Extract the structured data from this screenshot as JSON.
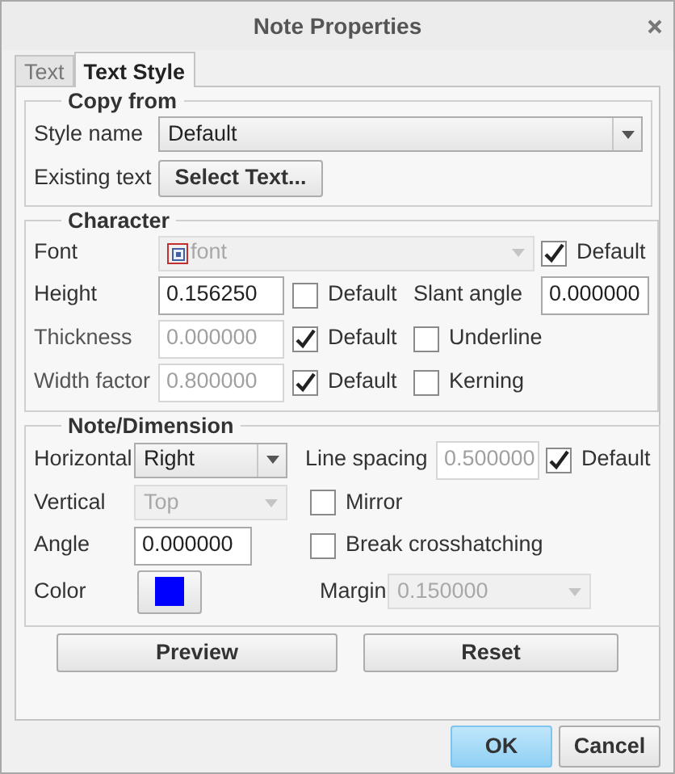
{
  "window": {
    "title": "Note Properties"
  },
  "tabs": [
    {
      "label": "Text",
      "selected": false
    },
    {
      "label": "Text Style",
      "selected": true
    }
  ],
  "copy_from": {
    "title": "Copy from",
    "style_name": {
      "label": "Style name",
      "value": "Default"
    },
    "existing_text": {
      "label": "Existing text",
      "button": "Select Text..."
    }
  },
  "character": {
    "title": "Character",
    "font": {
      "label": "Font",
      "value": "font",
      "disabled": true,
      "default": {
        "label": "Default",
        "checked": true
      }
    },
    "height": {
      "label": "Height",
      "value": "0.156250",
      "disabled": false,
      "default": {
        "label": "Default",
        "checked": false
      }
    },
    "slant_angle": {
      "label": "Slant angle",
      "value": "0.000000"
    },
    "thickness": {
      "label": "Thickness",
      "value": "0.000000",
      "disabled": true,
      "default": {
        "label": "Default",
        "checked": true
      }
    },
    "underline": {
      "label": "Underline",
      "checked": false
    },
    "width_factor": {
      "label": "Width factor",
      "value": "0.800000",
      "disabled": true,
      "default": {
        "label": "Default",
        "checked": true
      }
    },
    "kerning": {
      "label": "Kerning",
      "checked": false
    }
  },
  "note_dimension": {
    "title": "Note/Dimension",
    "horizontal": {
      "label": "Horizontal",
      "value": "Right",
      "disabled": false
    },
    "line_spacing": {
      "label": "Line spacing",
      "value": "0.500000",
      "disabled": true,
      "default": {
        "label": "Default",
        "checked": true
      }
    },
    "vertical": {
      "label": "Vertical",
      "value": "Top",
      "disabled": true
    },
    "mirror": {
      "label": "Mirror",
      "checked": false
    },
    "angle": {
      "label": "Angle",
      "value": "0.000000"
    },
    "break_crosshatching": {
      "label": "Break crosshatching",
      "checked": false
    },
    "color": {
      "label": "Color",
      "color": "#0000ff"
    },
    "margin": {
      "label": "Margin",
      "value": "0.150000",
      "disabled": true
    }
  },
  "actions": [
    {
      "label": "Preview"
    },
    {
      "label": "Reset"
    }
  ],
  "dialog_buttons": [
    {
      "label": "OK",
      "default": true
    },
    {
      "label": "Cancel",
      "default": false
    }
  ]
}
